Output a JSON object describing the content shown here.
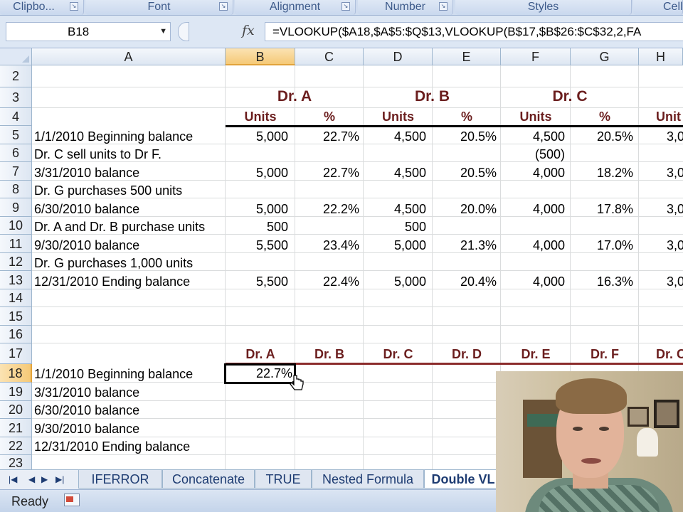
{
  "ribbon": {
    "groups": [
      "Clipbo...",
      "Font",
      "Alignment",
      "Number",
      "Styles",
      "Cell"
    ]
  },
  "formula_bar": {
    "name_box": "B18",
    "fx_label": "fx",
    "formula": "=VLOOKUP($A18,$A$5:$Q$13,VLOOKUP(B$17,$B$26:$C$32,2,FA"
  },
  "columns": [
    "A",
    "B",
    "C",
    "D",
    "E",
    "F",
    "G",
    "H"
  ],
  "rows": [
    "2",
    "3",
    "4",
    "5",
    "6",
    "7",
    "8",
    "9",
    "10",
    "11",
    "12",
    "13",
    "14",
    "15",
    "16",
    "17",
    "18",
    "19",
    "20",
    "21",
    "22",
    "23"
  ],
  "table": {
    "headers": {
      "dr_a": "Dr. A",
      "dr_b": "Dr. B",
      "dr_c": "Dr. C"
    },
    "subheaders": {
      "units": "Units",
      "pct": "%",
      "h_partial": "Unit"
    },
    "rows": [
      {
        "label": "1/1/2010 Beginning balance",
        "b": "5,000",
        "c": "22.7%",
        "d": "4,500",
        "e": "20.5%",
        "f": "4,500",
        "g": "20.5%",
        "h": "3,0"
      },
      {
        "label": "Dr. C sell units to Dr F.",
        "b": "",
        "c": "",
        "d": "",
        "e": "",
        "f": "(500)",
        "g": "",
        "h": ""
      },
      {
        "label": "3/31/2010 balance",
        "b": "5,000",
        "c": "22.7%",
        "d": "4,500",
        "e": "20.5%",
        "f": "4,000",
        "g": "18.2%",
        "h": "3,0"
      },
      {
        "label": "Dr. G purchases 500 units",
        "b": "",
        "c": "",
        "d": "",
        "e": "",
        "f": "",
        "g": "",
        "h": ""
      },
      {
        "label": "6/30/2010 balance",
        "b": "5,000",
        "c": "22.2%",
        "d": "4,500",
        "e": "20.0%",
        "f": "4,000",
        "g": "17.8%",
        "h": "3,0"
      },
      {
        "label": "Dr. A and Dr. B purchase units",
        "b": "500",
        "c": "",
        "d": "500",
        "e": "",
        "f": "",
        "g": "",
        "h": ""
      },
      {
        "label": "9/30/2010 balance",
        "b": "5,500",
        "c": "23.4%",
        "d": "5,000",
        "e": "21.3%",
        "f": "4,000",
        "g": "17.0%",
        "h": "3,0"
      },
      {
        "label": "Dr. G purchases 1,000 units",
        "b": "",
        "c": "",
        "d": "",
        "e": "",
        "f": "",
        "g": "",
        "h": ""
      },
      {
        "label": "12/31/2010 Ending balance",
        "b": "5,500",
        "c": "22.4%",
        "d": "5,000",
        "e": "20.4%",
        "f": "4,000",
        "g": "16.3%",
        "h": "3,0"
      }
    ]
  },
  "lookup": {
    "headers": [
      "Dr. A",
      "Dr. B",
      "Dr. C",
      "Dr. D",
      "Dr. E",
      "Dr. F",
      "Dr. C"
    ],
    "row_labels": [
      "1/1/2010 Beginning balance",
      "3/31/2010 balance",
      "6/30/2010 balance",
      "9/30/2010 balance",
      "12/31/2010 Ending balance"
    ],
    "active_value": "22.7%"
  },
  "sheet_tabs": {
    "tabs": [
      "IFERROR",
      "Concatenate",
      "TRUE",
      "Nested Formula",
      "Double VL"
    ],
    "active": "Double VL"
  },
  "status_bar": {
    "text": "Ready"
  },
  "webcam": {
    "icon": "webcam-overlay"
  }
}
